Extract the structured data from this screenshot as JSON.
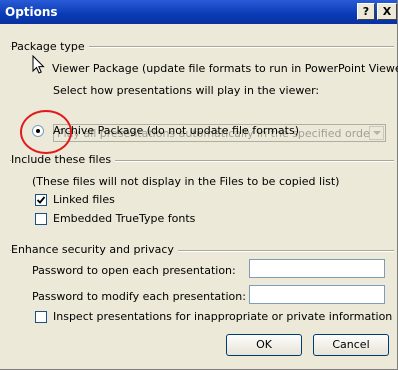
{
  "window": {
    "title": "Options",
    "help_label": "?",
    "close_label": "X"
  },
  "package_type": {
    "group_label": "Package type",
    "viewer_label": "Viewer Package (update file formats to run in PowerPoint Viewer)",
    "select_caption": "Select how presentations will play in the viewer:",
    "select_value": "Play all presentations automatically in the specified order",
    "archive_label": "Archive Package (do not update file formats)",
    "selected": "archive"
  },
  "include_files": {
    "group_label": "Include these files",
    "note": "(These files will not display in the Files to be copied list)",
    "linked_files_label": "Linked files",
    "linked_files_checked": true,
    "embedded_fonts_label": "Embedded TrueType fonts",
    "embedded_fonts_checked": false
  },
  "security": {
    "group_label": "Enhance security and privacy",
    "password_open_label": "Password to open each presentation:",
    "password_open_value": "",
    "password_modify_label": "Password to modify each presentation:",
    "password_modify_value": "",
    "inspect_label": "Inspect presentations for inappropriate or private information",
    "inspect_checked": false
  },
  "buttons": {
    "ok": "OK",
    "cancel": "Cancel"
  },
  "colors": {
    "titlebar": "#0a3bb5",
    "dialog_bg": "#ece9d8",
    "annotation": "#e11b1b"
  }
}
